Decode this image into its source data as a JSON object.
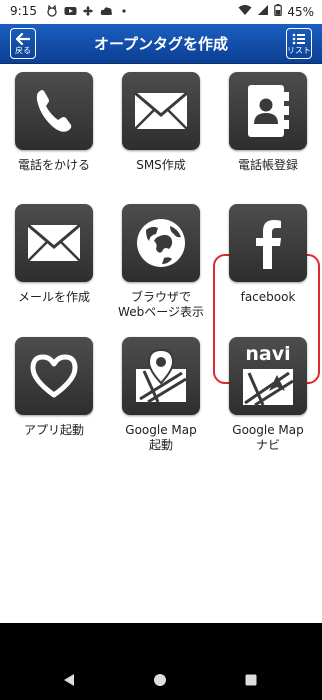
{
  "status_bar": {
    "time": "9:15",
    "battery": "45%",
    "icons": [
      "cat-icon",
      "video-icon",
      "fan-icon",
      "cloud-icon",
      "dot-icon",
      "wifi-icon",
      "signal-icon",
      "battery-icon"
    ]
  },
  "header": {
    "title": "オープンタグを作成",
    "back_label": "戻る",
    "list_label": "リスト"
  },
  "tiles": [
    {
      "label": "電話をかける",
      "icon": "phone-icon"
    },
    {
      "label": "SMS作成",
      "icon": "envelope-icon"
    },
    {
      "label": "電話帳登録",
      "icon": "address-book-icon"
    },
    {
      "label": "メールを作成",
      "icon": "mail-icon"
    },
    {
      "label": "ブラウザで\nWebページ表示",
      "icon": "globe-icon"
    },
    {
      "label": "facebook",
      "icon": "facebook-icon"
    },
    {
      "label": "アプリ起動",
      "icon": "heart-icon"
    },
    {
      "label": "Google Map\n起動",
      "icon": "map-pin-icon"
    },
    {
      "label": "Google Map\nナビ",
      "icon": "navi-map-icon"
    }
  ],
  "navi_text": "navi",
  "highlight_color": "#e0282e",
  "header_color": "#1b5fc0"
}
